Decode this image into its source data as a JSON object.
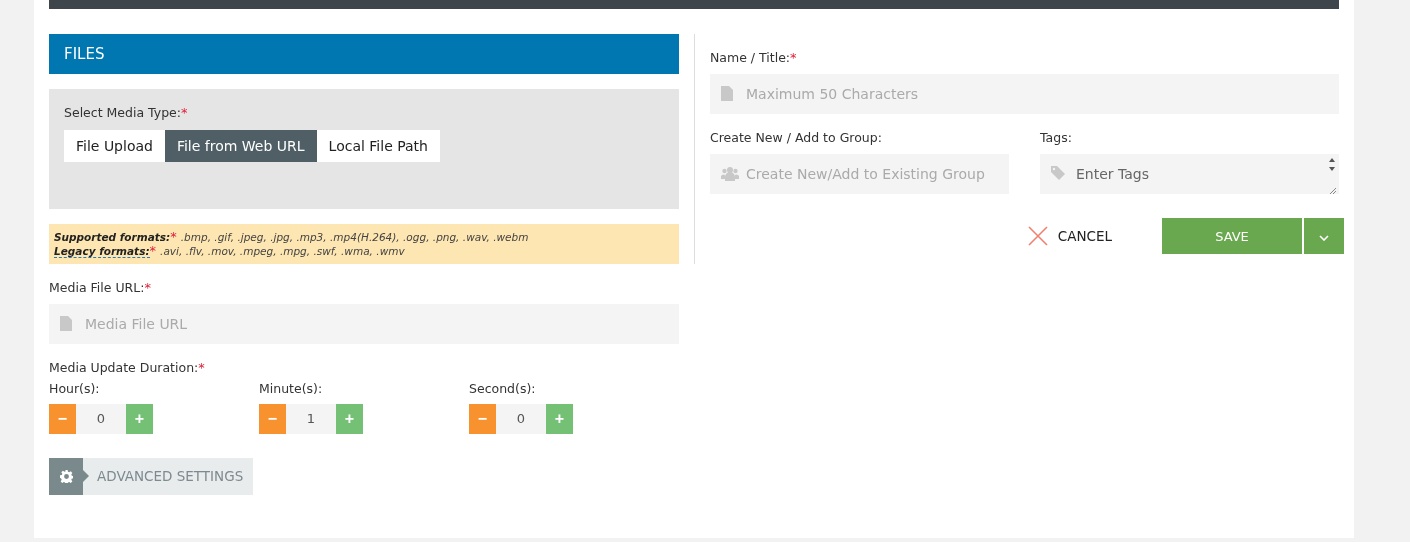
{
  "section_title": "FILES",
  "media_type": {
    "label": "Select Media Type:",
    "required_mark": "*",
    "options": [
      {
        "label": "File Upload",
        "selected": false
      },
      {
        "label": "File from Web URL",
        "selected": true
      },
      {
        "label": "Local File Path",
        "selected": false
      }
    ]
  },
  "formats": [
    {
      "term": "Supported formats:",
      "mark": "*",
      "list": ".bmp, .gif, .jpeg, .jpg, .mp3, .mp4(H.264), .ogg, .png, .wav, .webm",
      "underlined": false
    },
    {
      "term": "Legacy formats:",
      "mark": "*",
      "list": ".avi, .flv, .mov, .mpeg, .mpg, .swf, .wma, .wmv",
      "underlined": true
    }
  ],
  "media_url": {
    "label": "Media File URL:",
    "required_mark": "*",
    "placeholder": "Media File URL"
  },
  "duration": {
    "label": "Media Update Duration:",
    "required_mark": "*",
    "minus": "−",
    "plus": "+",
    "fields": [
      {
        "label": "Hour(s):",
        "value": "0"
      },
      {
        "label": "Minute(s):",
        "value": "1"
      },
      {
        "label": "Second(s):",
        "value": "0"
      }
    ]
  },
  "advanced": "ADVANCED SETTINGS",
  "name": {
    "label": "Name / Title:",
    "required_mark": "*",
    "placeholder": "Maximum 50 Characters"
  },
  "group": {
    "label": "Create New / Add to Group:",
    "placeholder": "Create New/Add to Existing Group"
  },
  "tags": {
    "label": "Tags:",
    "placeholder": "Enter Tags"
  },
  "cancel": "CANCEL",
  "save": "SAVE"
}
